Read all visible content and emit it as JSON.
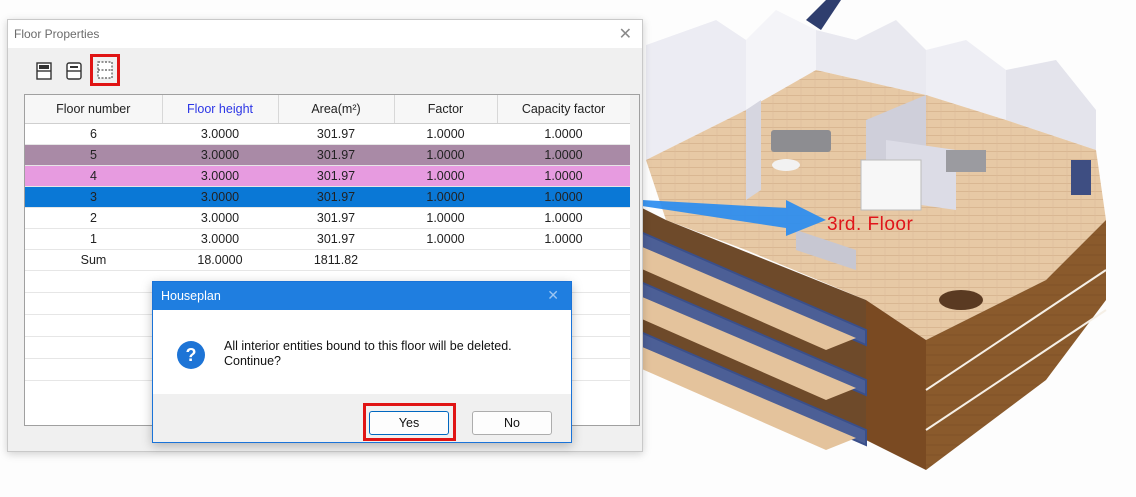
{
  "floor_properties": {
    "title": "Floor Properties",
    "toolbar": [
      {
        "name": "insert-floor-icon",
        "highlighted": false
      },
      {
        "name": "copy-floor-icon",
        "highlighted": false
      },
      {
        "name": "delete-floor-icon",
        "highlighted": true
      }
    ],
    "columns": [
      "Floor number",
      "Floor height",
      "Area(m²)",
      "Factor",
      "Capacity factor"
    ],
    "highlight_column": "Floor height",
    "rows": [
      {
        "floor": "6",
        "height": "3.0000",
        "area": "301.97",
        "factor": "1.0000",
        "capacity": "1.0000",
        "color": "#ffffff"
      },
      {
        "floor": "5",
        "height": "3.0000",
        "area": "301.97",
        "factor": "1.0000",
        "capacity": "1.0000",
        "color": "#a98aa6"
      },
      {
        "floor": "4",
        "height": "3.0000",
        "area": "301.97",
        "factor": "1.0000",
        "capacity": "1.0000",
        "color": "#e79be0"
      },
      {
        "floor": "3",
        "height": "3.0000",
        "area": "301.97",
        "factor": "1.0000",
        "capacity": "1.0000",
        "color": "#0a78d6"
      },
      {
        "floor": "2",
        "height": "3.0000",
        "area": "301.97",
        "factor": "1.0000",
        "capacity": "1.0000",
        "color": "#ffffff"
      },
      {
        "floor": "1",
        "height": "3.0000",
        "area": "301.97",
        "factor": "1.0000",
        "capacity": "1.0000",
        "color": "#ffffff"
      }
    ],
    "sum_row": {
      "label": "Sum",
      "height": "18.0000",
      "area": "1811.82"
    }
  },
  "dialog": {
    "title": "Houseplan",
    "icon": "question-icon",
    "message_line1": "All interior entities bound to this floor will be deleted.",
    "message_line2": "Continue?",
    "yes_label": "Yes",
    "no_label": "No"
  },
  "illustration": {
    "floor_label": "3rd. Floor",
    "accent_color": "#e0151a",
    "arrow_color": "#2a8cf0"
  }
}
